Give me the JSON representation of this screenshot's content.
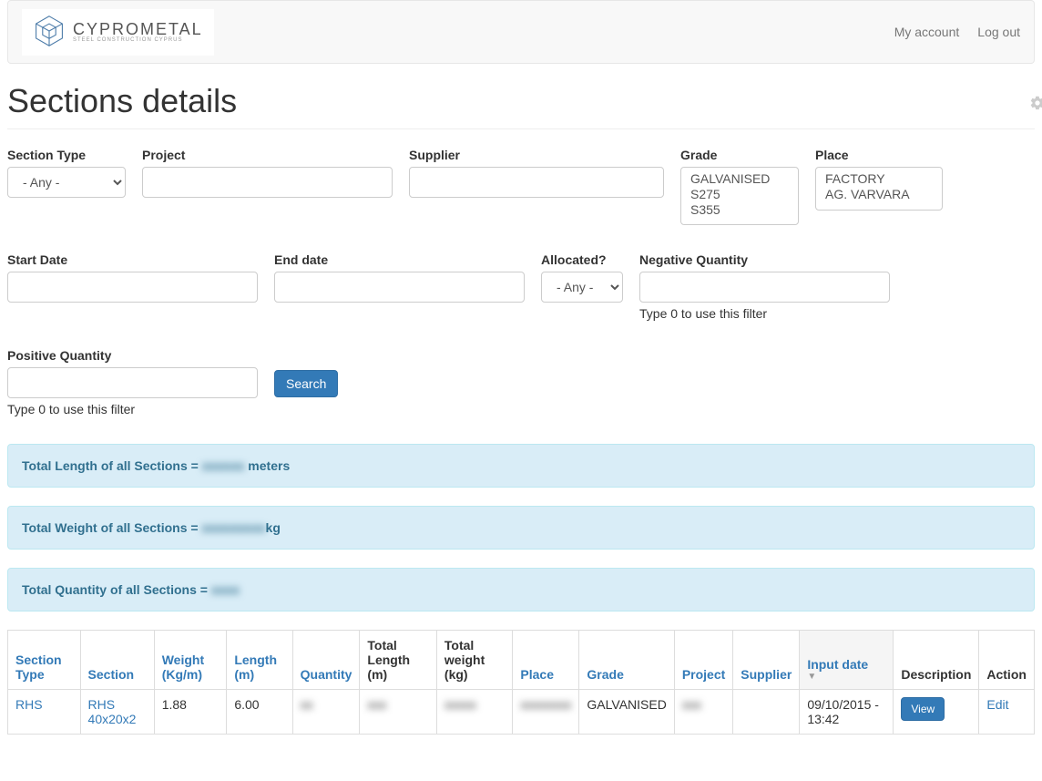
{
  "nav": {
    "brand_name": "CYPROMETAL",
    "brand_tag": "STEEL CONSTRUCTION CYPRUS",
    "my_account": "My account",
    "logout": "Log out"
  },
  "page": {
    "title": "Sections details"
  },
  "filters": {
    "section_type": {
      "label": "Section Type",
      "options": [
        "- Any -"
      ],
      "value": "- Any -"
    },
    "project": {
      "label": "Project",
      "value": ""
    },
    "supplier": {
      "label": "Supplier",
      "value": ""
    },
    "grade": {
      "label": "Grade",
      "options": [
        "GALVANISED",
        "S275",
        "S355"
      ]
    },
    "place": {
      "label": "Place",
      "options": [
        "FACTORY",
        "AG. VARVARA"
      ]
    },
    "start_date": {
      "label": "Start Date",
      "value": ""
    },
    "end_date": {
      "label": "End date",
      "value": ""
    },
    "allocated": {
      "label": "Allocated?",
      "options": [
        "- Any -"
      ],
      "value": "- Any -"
    },
    "neg_qty": {
      "label": "Negative Quantity",
      "value": "",
      "help": "Type 0 to use this filter"
    },
    "pos_qty": {
      "label": "Positive Quantity",
      "value": "",
      "help": "Type 0 to use this filter"
    },
    "search": "Search"
  },
  "summaries": {
    "length_prefix": "Total Length of all Sections = ",
    "length_value": "xxxxxx",
    "length_suffix": " meters",
    "weight_prefix": "Total Weight of all Sections = ",
    "weight_value": "xxxxxxxxx",
    "weight_suffix": "kg",
    "quantity_prefix": "Total Quantity of all Sections = ",
    "quantity_value": "xxxx"
  },
  "table": {
    "headers": {
      "section_type": "Section Type",
      "section": "Section",
      "weight": "Weight (Kg/m)",
      "length": "Length (m)",
      "quantity": "Quantity",
      "total_length": "Total Length (m)",
      "total_weight": "Total weight (kg)",
      "place": "Place",
      "grade": "Grade",
      "project": "Project",
      "supplier": "Supplier",
      "input_date": "Input date",
      "description": "Description",
      "action": "Action"
    },
    "rows": [
      {
        "section_type": "RHS",
        "section": "RHS 40x20x2",
        "weight": "1.88",
        "length": "6.00",
        "quantity": "xx",
        "total_length": "xxx",
        "total_weight": "xxxxx",
        "place": "xxxxxxxx",
        "grade": "GALVANISED",
        "project": "xxx",
        "supplier": "",
        "input_date": "09/10/2015 - 13:42",
        "view": "View",
        "edit": "Edit"
      }
    ]
  }
}
